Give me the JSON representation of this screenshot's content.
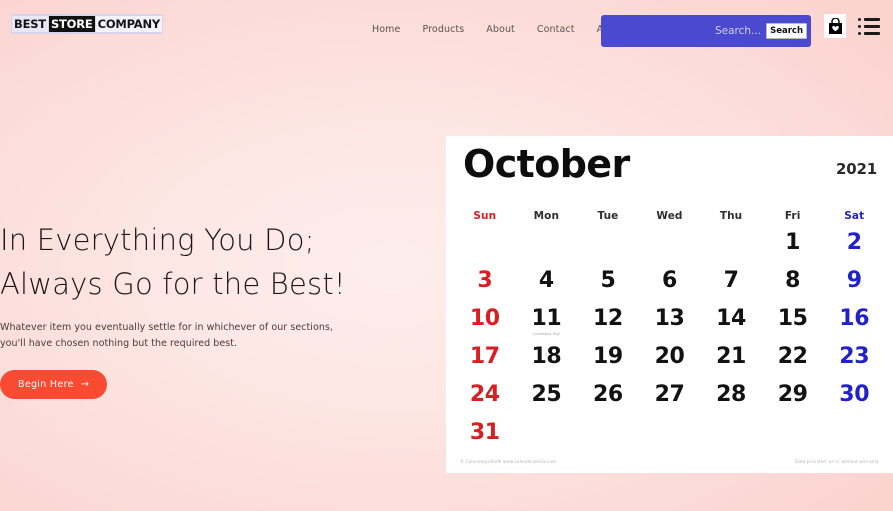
{
  "header": {
    "logo": {
      "part1": "BEST",
      "part2": "STORE",
      "part3": "COMPANY"
    },
    "nav": [
      {
        "label": "Home"
      },
      {
        "label": "Products"
      },
      {
        "label": "About"
      },
      {
        "label": "Contact"
      },
      {
        "label": "Account"
      }
    ],
    "search": {
      "placeholder": "Search...",
      "value": "",
      "button_label": "Search",
      "box_color": "#4a49cf"
    },
    "icons": {
      "bag": "shopping-bag-heart-icon",
      "menu": "hamburger-list-icon"
    }
  },
  "hero": {
    "title_line1": "In Everything You Do;",
    "title_line2": "Always Go for the Best!",
    "subtitle_line1": "Whatever item you eventually settle for in whichever of our sections,",
    "subtitle_line2": "you'll have chosen nothing but the required best.",
    "cta_label": "Begin Here",
    "cta_arrow": "→",
    "cta_color": "#fa4a32"
  },
  "calendar": {
    "month": "October",
    "year": "2021",
    "dow": [
      "Sun",
      "Mon",
      "Tue",
      "Wed",
      "Thu",
      "Fri",
      "Sat"
    ],
    "weeks": [
      [
        "",
        "",
        "",
        "",
        "",
        "1",
        "2"
      ],
      [
        "3",
        "4",
        "5",
        "6",
        "7",
        "8",
        "9"
      ],
      [
        "10",
        "11",
        "12",
        "13",
        "14",
        "15",
        "16"
      ],
      [
        "17",
        "18",
        "19",
        "20",
        "21",
        "22",
        "23"
      ],
      [
        "24",
        "25",
        "26",
        "27",
        "28",
        "29",
        "30"
      ],
      [
        "31",
        "",
        "",
        "",
        "",
        "",
        ""
      ]
    ],
    "holidays": {
      "11": "Columbus Day"
    },
    "footer_left": "© Calendarpedia®   www.calendarpedia.com",
    "footer_right": "Data provided 'as is' without warranty",
    "colors": {
      "sunday": "#d81f23",
      "saturday": "#2222cc",
      "weekday": "#121212"
    }
  },
  "background": {
    "base": "#fad0cc",
    "center": "#fdeeec"
  }
}
